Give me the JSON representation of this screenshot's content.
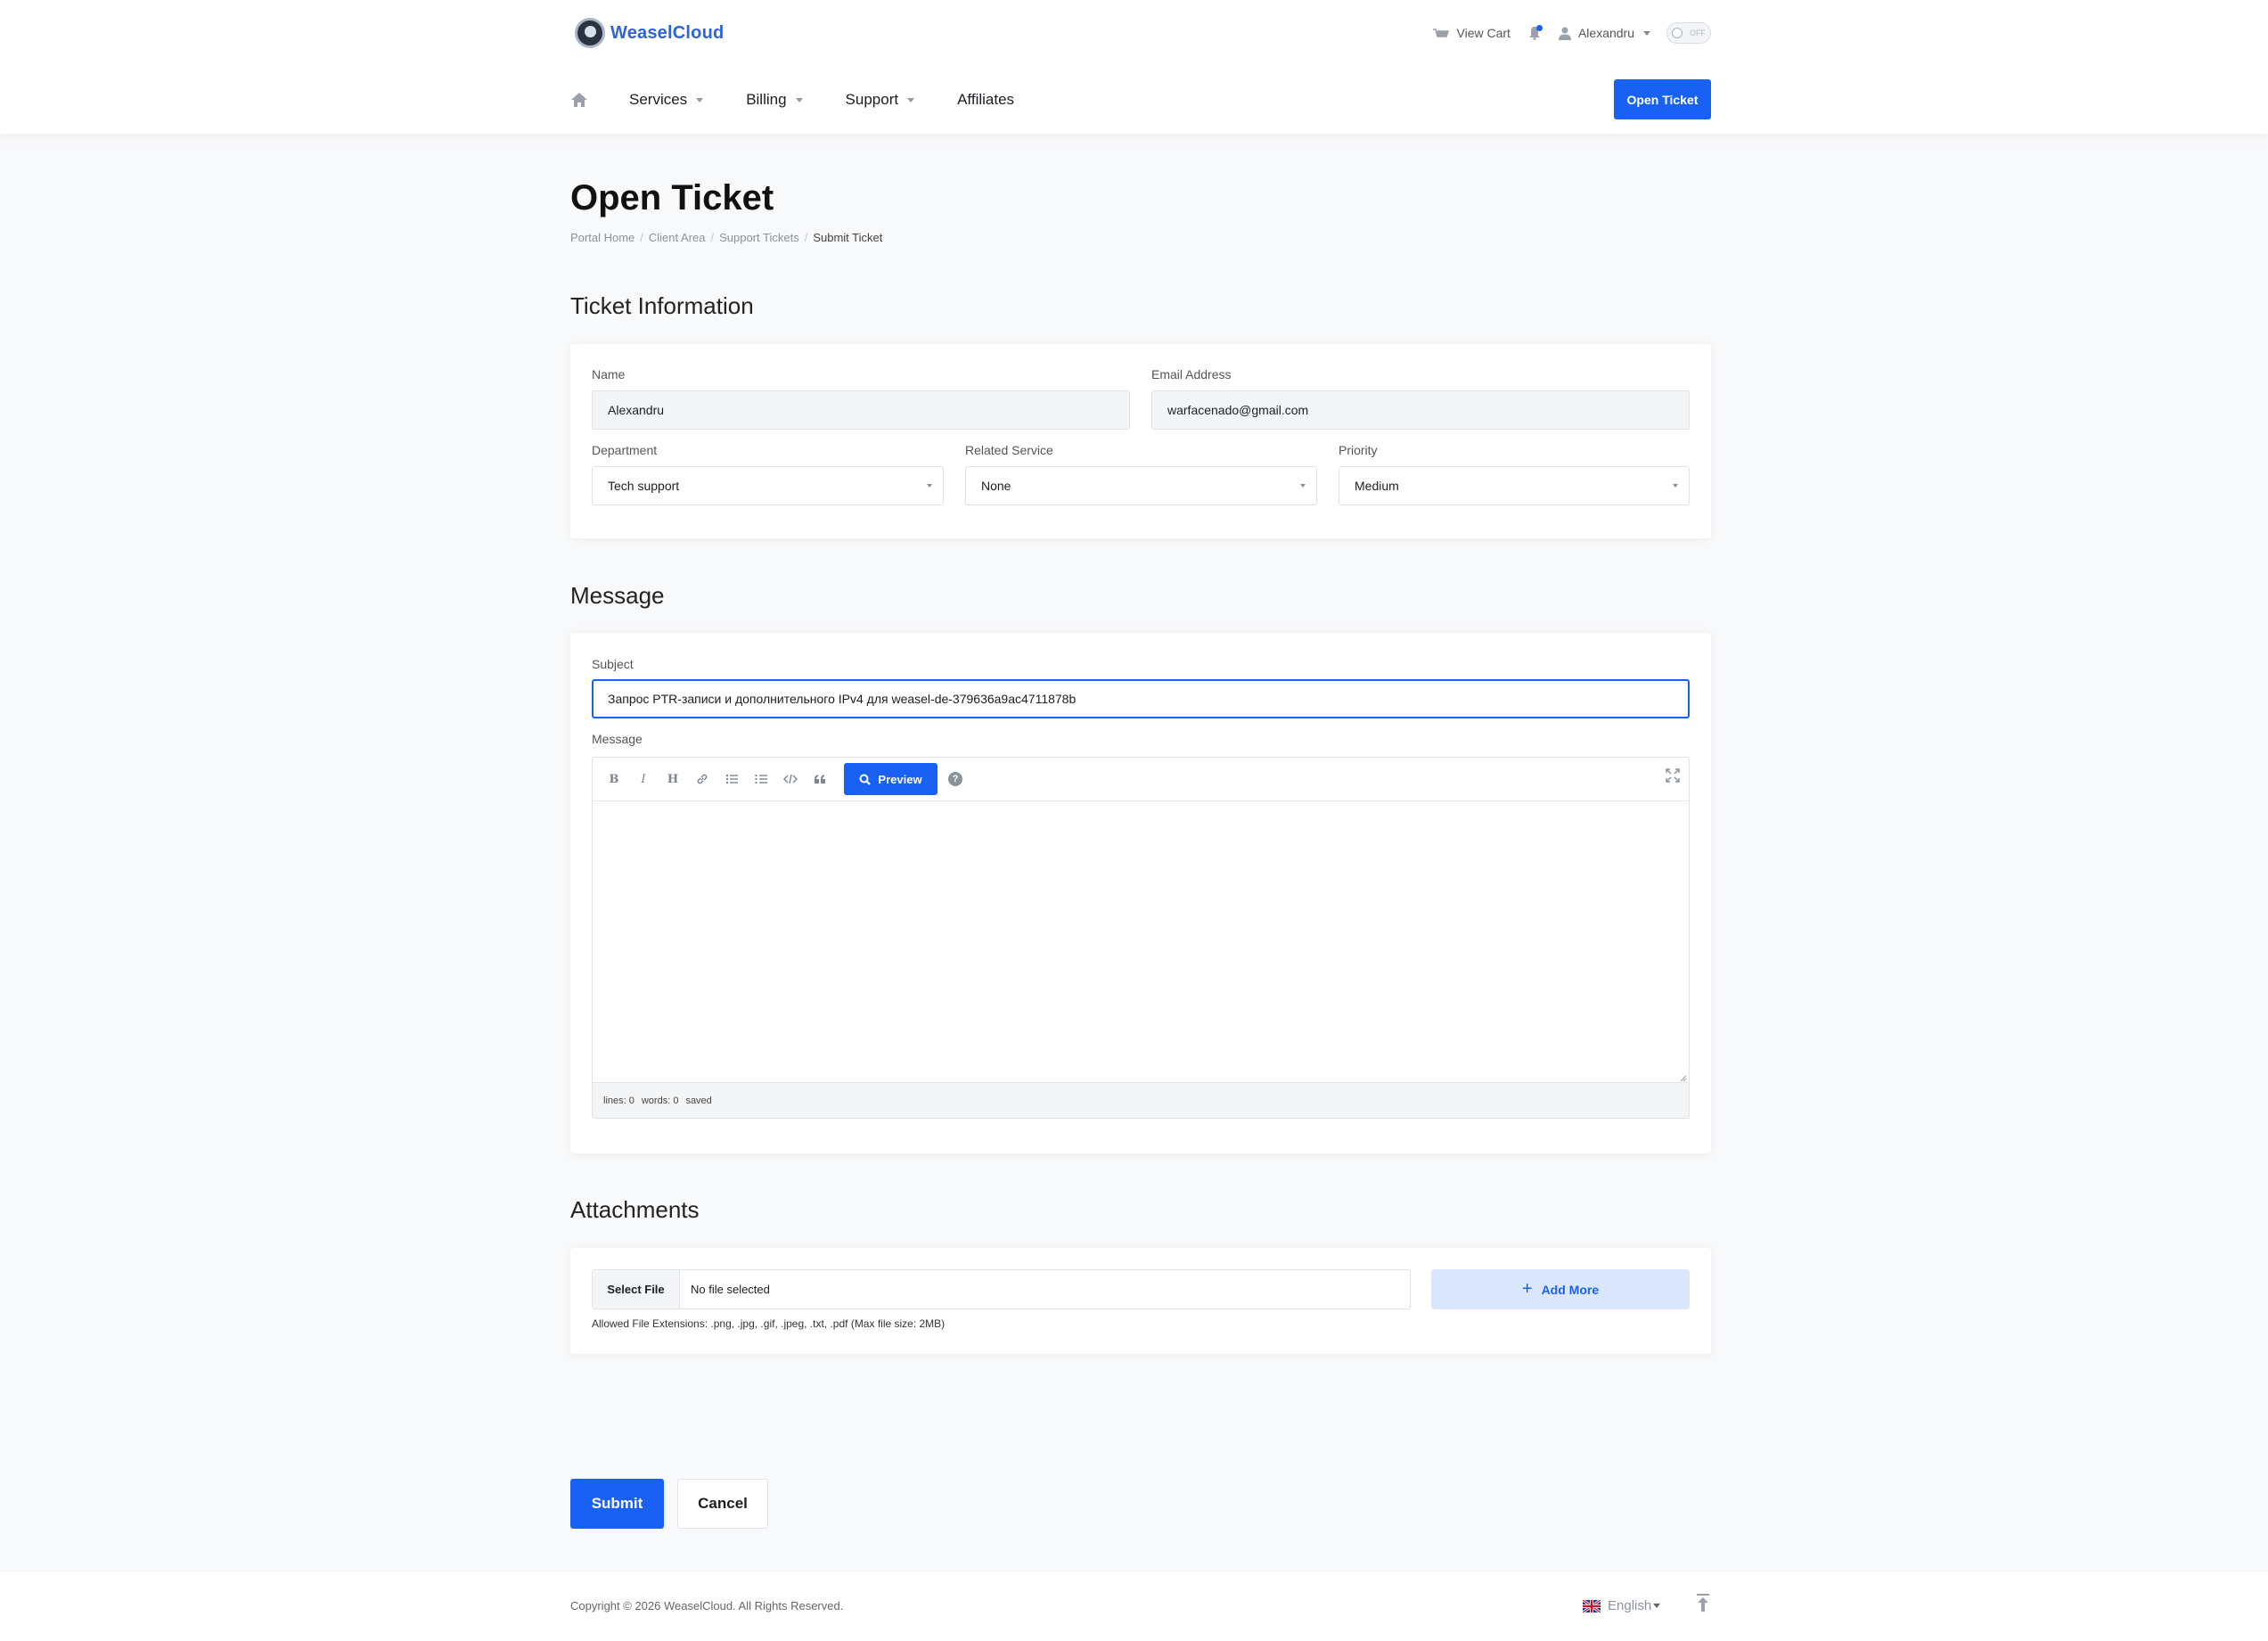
{
  "brand": {
    "name": "WeaselCloud",
    "accent": "#1961f3"
  },
  "topbar": {
    "view_cart": "View Cart",
    "user_name": "Alexandru",
    "theme_toggle_state": "OFF"
  },
  "nav": {
    "items": [
      {
        "label": "Services",
        "dropdown": true
      },
      {
        "label": "Billing",
        "dropdown": true
      },
      {
        "label": "Support",
        "dropdown": true
      },
      {
        "label": "Affiliates",
        "dropdown": false
      }
    ],
    "open_ticket_label": "Open Ticket"
  },
  "page": {
    "title": "Open Ticket",
    "breadcrumb": [
      "Portal Home",
      "Client Area",
      "Support Tickets",
      "Submit Ticket"
    ]
  },
  "ticket_info": {
    "heading": "Ticket Information",
    "name_label": "Name",
    "name_value": "Alexandru",
    "email_label": "Email Address",
    "email_value": "warfacenado@gmail.com",
    "department_label": "Department",
    "department_value": "Tech support",
    "related_service_label": "Related Service",
    "related_service_value": "None",
    "priority_label": "Priority",
    "priority_value": "Medium"
  },
  "message": {
    "heading": "Message",
    "subject_label": "Subject",
    "subject_value": "Запрос PTR-записи и дополнительного IPv4 для weasel-de-379636a9ac4711878b",
    "message_label": "Message",
    "toolbar": {
      "bold": "B",
      "italic": "I",
      "heading": "H",
      "preview_label": "Preview",
      "help": "?"
    },
    "status": {
      "lines": "lines: 0",
      "words": "words: 0",
      "saved": "saved"
    }
  },
  "attachments": {
    "heading": "Attachments",
    "select_file_label": "Select File",
    "file_status": "No file selected",
    "add_more_label": "Add More",
    "allowed_text": "Allowed File Extensions: .png, .jpg, .gif, .jpeg, .txt, .pdf (Max file size: 2MB)"
  },
  "actions": {
    "submit_label": "Submit",
    "cancel_label": "Cancel"
  },
  "footer": {
    "copyright": "Copyright © 2026 WeaselCloud. All Rights Reserved.",
    "language": "English"
  }
}
